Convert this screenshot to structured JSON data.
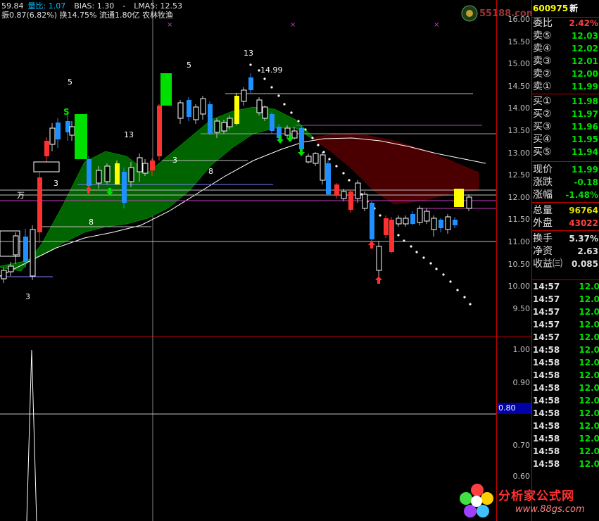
{
  "header": {
    "line1": [
      {
        "text": "59.84",
        "color": "#e0e0e0"
      },
      {
        "text": "量比: 1.07",
        "color": "#00c0ff"
      },
      {
        "text": "BIAS: 1.30",
        "color": "#e0e0e0"
      },
      {
        "text": "-",
        "color": "#e0e0e0"
      },
      {
        "text": "LMA5: 12.53",
        "color": "#e0e0e0"
      }
    ],
    "line2": "振0.87(6.82%) 换14.75% 流通1.80亿 农林牧渔"
  },
  "chart_labels": {
    "cnt_13_top": "13",
    "cnt_5_a": "5",
    "cnt_5_b": "5",
    "cnt_13_mid": "13",
    "cnt_3_a": "3",
    "cnt_3_b": "3",
    "cnt_8_a": "8",
    "cnt_8_b": "8",
    "cnt_3_c": "3",
    "peak_price": "14.99",
    "wan": "万",
    "s_mark": "S"
  },
  "axis": {
    "price_ticks": [
      "16.00",
      "15.50",
      "15.00",
      "14.50",
      "14.00",
      "13.50",
      "13.00",
      "12.50",
      "12.00",
      "11.50",
      "11.00",
      "10.50",
      "10.00",
      "9.50"
    ],
    "lower_ticks": [
      "1.00",
      "0.90",
      "0.70",
      "0.60"
    ],
    "lower_current": "0.80"
  },
  "quote": {
    "code": "600975",
    "code_suffix": "新",
    "rows": [
      {
        "label": "委比",
        "value": "2.42%",
        "color": "#ff4040"
      },
      {
        "label": "卖⑤",
        "value": "12.03",
        "color": "#00e000"
      },
      {
        "label": "卖④",
        "value": "12.02",
        "color": "#00e000"
      },
      {
        "label": "卖③",
        "value": "12.01",
        "color": "#00e000"
      },
      {
        "label": "卖②",
        "value": "12.00",
        "color": "#00e000"
      },
      {
        "label": "卖①",
        "value": "11.99",
        "color": "#00e000"
      },
      {
        "label": "买①",
        "value": "11.98",
        "color": "#00e000"
      },
      {
        "label": "买②",
        "value": "11.97",
        "color": "#00e000"
      },
      {
        "label": "买③",
        "value": "11.96",
        "color": "#00e000"
      },
      {
        "label": "买④",
        "value": "11.95",
        "color": "#00e000"
      },
      {
        "label": "买⑤",
        "value": "11.94",
        "color": "#00e000"
      },
      {
        "label": "现价",
        "value": "11.99",
        "color": "#00e000"
      },
      {
        "label": "涨跌",
        "value": "-0.18",
        "color": "#00e000"
      },
      {
        "label": "涨幅",
        "value": "-1.48%",
        "color": "#00e000"
      },
      {
        "label": "总量",
        "value": "96764",
        "color": "#e0e000"
      },
      {
        "label": "外盘",
        "value": "43022",
        "color": "#ff4040"
      },
      {
        "label": "换手",
        "value": "5.37%",
        "color": "#e0e0e0"
      },
      {
        "label": "净资",
        "value": "2.63",
        "color": "#e0e0e0"
      },
      {
        "label": "收益㈢",
        "value": "0.085",
        "color": "#e0e0e0"
      }
    ],
    "ticks": [
      {
        "time": "14:57",
        "price": "12.0"
      },
      {
        "time": "14:57",
        "price": "12.0"
      },
      {
        "time": "14:57",
        "price": "12.0"
      },
      {
        "time": "14:57",
        "price": "12.0"
      },
      {
        "time": "14:57",
        "price": "12.0"
      },
      {
        "time": "14:58",
        "price": "12.0"
      },
      {
        "time": "14:58",
        "price": "12.0"
      },
      {
        "time": "14:58",
        "price": "12.0"
      },
      {
        "time": "14:58",
        "price": "12.0"
      },
      {
        "time": "14:58",
        "price": "12.0"
      },
      {
        "time": "14:58",
        "price": "12.0"
      },
      {
        "time": "14:58",
        "price": "12.0"
      },
      {
        "time": "14:58",
        "price": "12.0"
      },
      {
        "time": "14:58",
        "price": "12.0"
      },
      {
        "time": "14:58",
        "price": "12.0"
      }
    ]
  },
  "logos": {
    "top_text": "55188.com",
    "bottom_text": "分析家公式网",
    "bottom_url": "www.88gs.com"
  },
  "colors": {
    "up": "#ff3030",
    "down": "#1e90ff",
    "green_band": "#006400",
    "red_band": "#4a0000",
    "ma_white": "#ffffff"
  }
}
